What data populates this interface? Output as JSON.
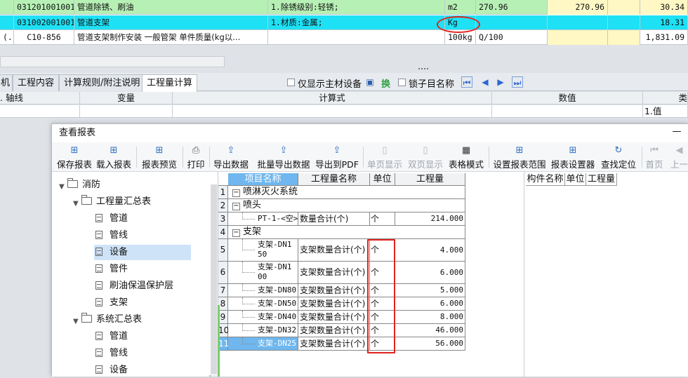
{
  "top_grid": {
    "rows": [
      {
        "code": "031201001001",
        "name": "管道除锈、刷油",
        "feature": "1.除锈级别:轻锈;",
        "unit": "m2",
        "qty": "270.96",
        "price": "270.96",
        "total": "30.34"
      },
      {
        "code": "031002001001",
        "name": "管道支架",
        "feature": "1.材质:金属;",
        "unit": "Kg",
        "qty": "",
        "price": "",
        "total": "18.31"
      },
      {
        "code": "C10-856",
        "prefix": "(.",
        "name": "管道支架制作安装 一般管架 单件质量(kg以...",
        "feature": "",
        "unit": "100kg",
        "qty": "Q/100",
        "price": "",
        "total": "1,831.09"
      }
    ]
  },
  "tabs": [
    {
      "label": "机"
    },
    {
      "label": "工程内容"
    },
    {
      "label": "计算规则/附注说明"
    },
    {
      "label": "工程量计算"
    }
  ],
  "options": {
    "main_only": "仅显示主材设备",
    "swap": "换",
    "lock_sub": "锁子目名称"
  },
  "calc_header": {
    "col1": ". 轴线",
    "col2": "变量",
    "col3": "计算式",
    "col4": "数值",
    "col5": "类"
  },
  "calc_row": {
    "type_value": "1.值"
  },
  "dialog": {
    "title": "查看报表",
    "minimize": "—",
    "toolbar": [
      {
        "label": "保存报表",
        "icon": "grid-save-icon",
        "enabled": true
      },
      {
        "label": "载入报表",
        "icon": "grid-load-icon",
        "enabled": true
      },
      {
        "label": "报表预览",
        "icon": "grid-preview-icon",
        "enabled": true
      },
      {
        "label": "打印",
        "icon": "printer-icon",
        "enabled": true
      },
      {
        "label": "导出数据",
        "icon": "export-data-icon",
        "enabled": true
      },
      {
        "label": "批量导出数据",
        "icon": "batch-export-icon",
        "enabled": true
      },
      {
        "label": "导出到PDF",
        "icon": "pdf-export-icon",
        "enabled": true
      },
      {
        "label": "单页显示",
        "icon": "single-page-icon",
        "enabled": false
      },
      {
        "label": "双页显示",
        "icon": "double-page-icon",
        "enabled": false
      },
      {
        "label": "表格模式",
        "icon": "table-mode-icon",
        "enabled": true
      },
      {
        "label": "设置报表范围",
        "icon": "report-range-icon",
        "enabled": true
      },
      {
        "label": "报表设置器",
        "icon": "report-settings-icon",
        "enabled": true
      },
      {
        "label": "查找定位",
        "icon": "find-locate-icon",
        "enabled": true
      },
      {
        "label": "首页",
        "icon": "first-page-icon",
        "enabled": false
      },
      {
        "label": "上一",
        "icon": "prev-page-icon",
        "enabled": false
      }
    ],
    "tree": [
      {
        "label": "消防",
        "level": 0,
        "type": "folder",
        "expanded": true
      },
      {
        "label": "工程量汇总表",
        "level": 1,
        "type": "folder",
        "expanded": true
      },
      {
        "label": "管道",
        "level": 2,
        "type": "doc"
      },
      {
        "label": "管线",
        "level": 2,
        "type": "doc"
      },
      {
        "label": "设备",
        "level": 2,
        "type": "doc",
        "selected": true
      },
      {
        "label": "管件",
        "level": 2,
        "type": "doc"
      },
      {
        "label": "刷油保温保护层",
        "level": 2,
        "type": "doc"
      },
      {
        "label": "支架",
        "level": 2,
        "type": "doc"
      },
      {
        "label": "系统汇总表",
        "level": 1,
        "type": "folder",
        "expanded": true
      },
      {
        "label": "管道",
        "level": 2,
        "type": "doc"
      },
      {
        "label": "管线",
        "level": 2,
        "type": "doc"
      },
      {
        "label": "设备",
        "level": 2,
        "type": "doc"
      }
    ],
    "report_headers": {
      "item": "项目名称",
      "qty_name": "工程量名称",
      "unit": "单位",
      "qty": "工程量"
    },
    "report_rows": [
      {
        "n": "1",
        "item": "喷淋灭火系统",
        "group": true,
        "expander": "−"
      },
      {
        "n": "2",
        "item": "喷头",
        "group": true,
        "expander": "−"
      },
      {
        "n": "3",
        "item": "PT-1-<空>",
        "qty_name": "数量合计(个)",
        "unit": "个",
        "qty": "214.000"
      },
      {
        "n": "4",
        "item": "支架",
        "group": true,
        "expander": "−"
      },
      {
        "n": "5",
        "item": "支架-DN150",
        "qty_name": "支架数量合计(个)",
        "unit": "个",
        "qty": "4.000"
      },
      {
        "n": "6",
        "item": "支架-DN100",
        "qty_name": "支架数量合计(个)",
        "unit": "个",
        "qty": "6.000"
      },
      {
        "n": "7",
        "item": "支架-DN80",
        "qty_name": "支架数量合计(个)",
        "unit": "个",
        "qty": "5.000"
      },
      {
        "n": "8",
        "item": "支架-DN50",
        "qty_name": "支架数量合计(个)",
        "unit": "个",
        "qty": "6.000"
      },
      {
        "n": "9",
        "item": "支架-DN40",
        "qty_name": "支架数量合计(个)",
        "unit": "个",
        "qty": "8.000"
      },
      {
        "n": "10",
        "item": "支架-DN32",
        "qty_name": "支架数量合计(个)",
        "unit": "个",
        "qty": "46.000"
      },
      {
        "n": "11",
        "item": "支架-DN25",
        "qty_name": "支架数量合计(个)",
        "unit": "个",
        "qty": "56.000",
        "selected": true
      }
    ],
    "right_headers": {
      "c1": "构件名称",
      "c2": "单位",
      "c3": "工程量"
    }
  },
  "colors": {
    "row_green": "#b7f0b5",
    "row_cyan": "#1ee1f5",
    "annotation_red": "#e0241e",
    "selection_blue": "#cfe3f8"
  }
}
